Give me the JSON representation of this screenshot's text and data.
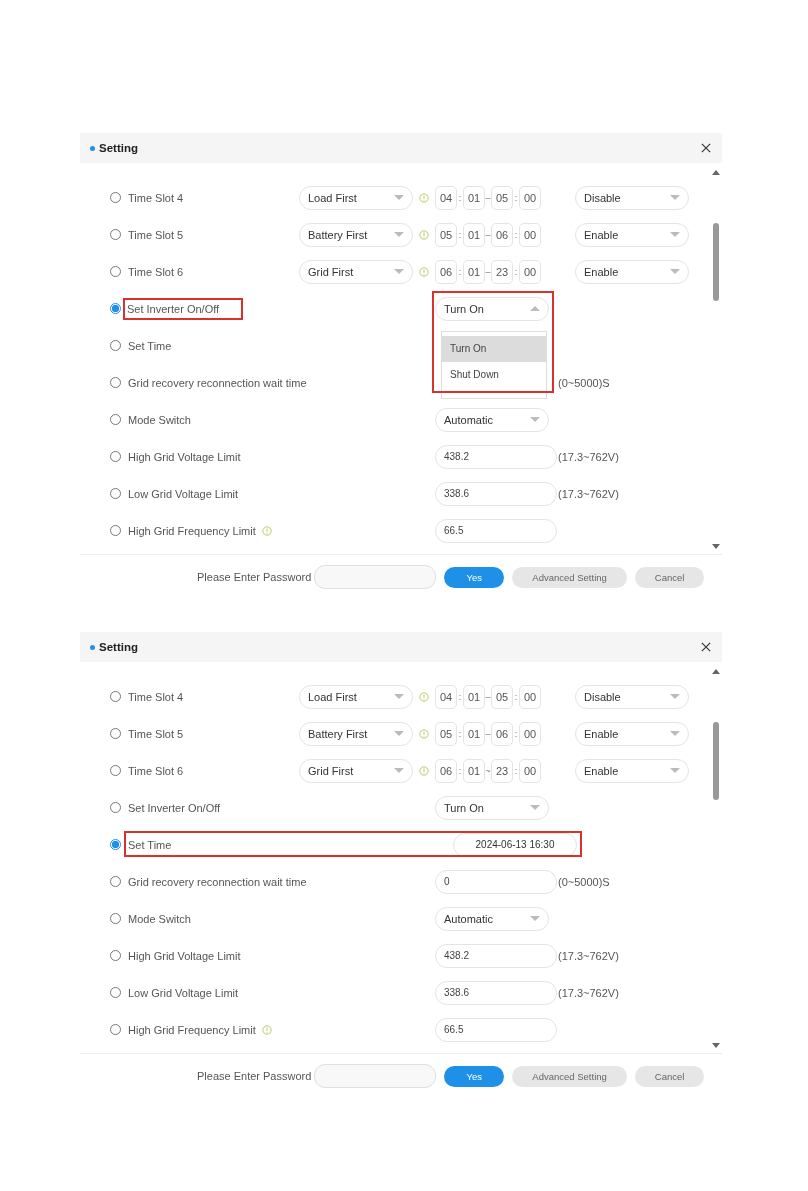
{
  "dialogs": [
    {
      "title": "Setting",
      "rows": [
        {
          "kind": "timeslot",
          "label": "Time Slot 4",
          "selected": false,
          "mode": "Load First",
          "start_hour": "04",
          "start_minute": "01",
          "separator": "–",
          "end_hour": "05",
          "end_minute": "00",
          "colon": ":",
          "status": "Disable"
        },
        {
          "kind": "timeslot",
          "label": "Time Slot 5",
          "selected": false,
          "mode": "Battery First",
          "start_hour": "05",
          "start_minute": "01",
          "separator": "–",
          "end_hour": "06",
          "end_minute": "00",
          "colon": ":",
          "status": "Enable"
        },
        {
          "kind": "timeslot",
          "label": "Time Slot 6",
          "selected": false,
          "mode": "Grid First",
          "start_hour": "06",
          "start_minute": "01",
          "separator": "–",
          "end_hour": "23",
          "end_minute": "00",
          "colon": ":",
          "status": "Enable"
        },
        {
          "kind": "select",
          "label": "Set Inverter On/Off",
          "selected": true,
          "value": "Turn On",
          "open": true,
          "highlight_label": true,
          "highlight_control": true,
          "options": [
            {
              "label": "Turn On",
              "selected": true
            },
            {
              "label": "Shut Down",
              "selected": false
            }
          ]
        },
        {
          "kind": "date",
          "label": "Set Time",
          "selected": false
        },
        {
          "kind": "input",
          "label": "Grid recovery reconnection wait time",
          "selected": false,
          "range": "(0~5000)S"
        },
        {
          "kind": "select",
          "label": "Mode Switch",
          "selected": false,
          "value": "Automatic",
          "open": false
        },
        {
          "kind": "input",
          "label": "High Grid Voltage Limit",
          "selected": false,
          "value": "438.2",
          "range": "(17.3~762V)"
        },
        {
          "kind": "input",
          "label": "Low Grid Voltage Limit",
          "selected": false,
          "value": "338.6",
          "range": "(17.3~762V)"
        },
        {
          "kind": "input",
          "label": "High Grid Frequency Limit",
          "selected": false,
          "value": "66.5",
          "info": true
        }
      ],
      "footer": {
        "password_label": "Please Enter Password",
        "buttons": [
          {
            "label": "Yes",
            "kind": "primary"
          },
          {
            "label": "Advanced Setting",
            "kind": "secondary"
          },
          {
            "label": "Cancel",
            "kind": "secondary"
          }
        ]
      }
    },
    {
      "title": "Setting",
      "rows": [
        {
          "kind": "timeslot",
          "label": "Time Slot 4",
          "selected": false,
          "mode": "Load First",
          "start_hour": "04",
          "start_minute": "01",
          "separator": "–",
          "end_hour": "05",
          "end_minute": "00",
          "colon": ":",
          "status": "Disable"
        },
        {
          "kind": "timeslot",
          "label": "Time Slot 5",
          "selected": false,
          "mode": "Battery First",
          "start_hour": "05",
          "start_minute": "01",
          "separator": "–",
          "end_hour": "06",
          "end_minute": "00",
          "colon": ":",
          "status": "Enable"
        },
        {
          "kind": "timeslot",
          "label": "Time Slot 6",
          "selected": false,
          "mode": "Grid First",
          "start_hour": "06",
          "start_minute": "01",
          "separator": "~",
          "end_hour": "23",
          "end_minute": "00",
          "colon": ":",
          "status": "Enable"
        },
        {
          "kind": "select",
          "label": "Set Inverter On/Off",
          "selected": false,
          "value": "Turn On",
          "open": false
        },
        {
          "kind": "date",
          "label": "Set Time",
          "selected": true,
          "value": "2024-06-13 16:30",
          "highlight_row": true
        },
        {
          "kind": "input",
          "label": "Grid recovery reconnection wait time",
          "selected": false,
          "value": "0",
          "range": "(0~5000)S"
        },
        {
          "kind": "select",
          "label": "Mode Switch",
          "selected": false,
          "value": "Automatic",
          "open": false
        },
        {
          "kind": "input",
          "label": "High Grid Voltage Limit",
          "selected": false,
          "value": "438.2",
          "range": "(17.3~762V)"
        },
        {
          "kind": "input",
          "label": "Low Grid Voltage Limit",
          "selected": false,
          "value": "338.6",
          "range": "(17.3~762V)"
        },
        {
          "kind": "input",
          "label": "High Grid Frequency Limit",
          "selected": false,
          "value": "66.5",
          "info": true
        }
      ],
      "footer": {
        "password_label": "Please Enter Password",
        "buttons": [
          {
            "label": "Yes",
            "kind": "primary"
          },
          {
            "label": "Advanced Setting",
            "kind": "secondary"
          },
          {
            "label": "Cancel",
            "kind": "secondary"
          }
        ]
      }
    }
  ]
}
